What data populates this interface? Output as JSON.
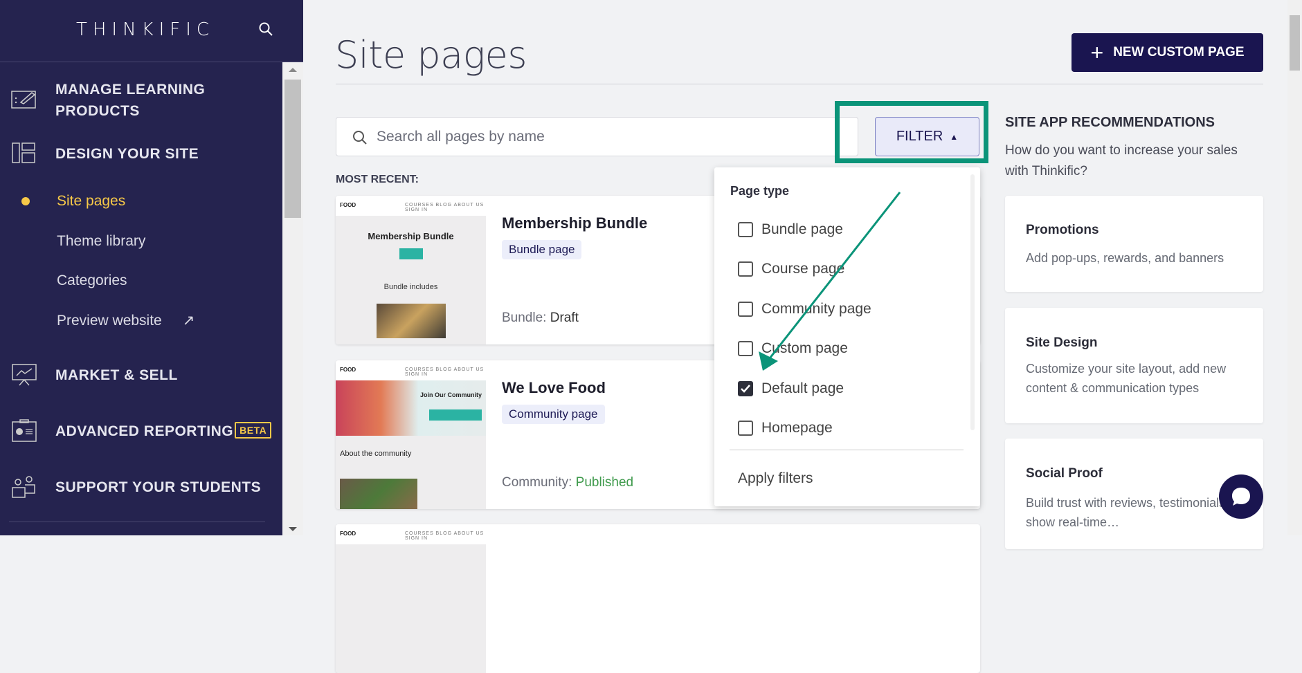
{
  "sidebar": {
    "logo": "THINKIFIC",
    "items": [
      {
        "label": "MANAGE LEARNING PRODUCTS",
        "icon": "edit-board-icon"
      },
      {
        "label": "DESIGN YOUR SITE",
        "icon": "layout-icon"
      },
      {
        "label": "MARKET & SELL",
        "icon": "presentation-chart-icon"
      },
      {
        "label": "ADVANCED REPORTING",
        "badge": "BETA",
        "icon": "report-icon"
      },
      {
        "label": "SUPPORT YOUR STUDENTS",
        "icon": "users-icon"
      }
    ],
    "subitems": [
      {
        "label": "Site pages",
        "active": true
      },
      {
        "label": "Theme library"
      },
      {
        "label": "Categories"
      },
      {
        "label": "Preview website",
        "icon": "external-link-icon"
      }
    ]
  },
  "header": {
    "title": "Site pages",
    "new_button": "NEW CUSTOM PAGE"
  },
  "search": {
    "placeholder": "Search all pages by name",
    "value": ""
  },
  "filter": {
    "label": "FILTER",
    "heading": "Page type",
    "options": [
      {
        "label": "Bundle page",
        "checked": false
      },
      {
        "label": "Course page",
        "checked": false
      },
      {
        "label": "Community page",
        "checked": false
      },
      {
        "label": "Custom page",
        "checked": false
      },
      {
        "label": "Default page",
        "checked": true
      },
      {
        "label": "Homepage",
        "checked": false
      }
    ],
    "apply": "Apply filters"
  },
  "recent_label": "MOST RECENT:",
  "pages": [
    {
      "title": "Membership Bundle",
      "badge": "Bundle page",
      "status_label": "Bundle:",
      "status": "Draft",
      "thumb": {
        "brand": "FOOD",
        "nav": "COURSES BLOG ABOUT US SIGN IN",
        "heading": "Membership Bundle",
        "sub": "Bundle includes"
      }
    },
    {
      "title": "We Love Food",
      "badge": "Community page",
      "status_label": "Community:",
      "status": "Published",
      "thumb": {
        "brand": "FOOD",
        "nav": "COURSES BLOG ABOUT US SIGN IN",
        "heading": "Join Our Community",
        "sub": "About the community"
      }
    },
    {
      "thumb": {
        "brand": "FOOD",
        "nav": "COURSES BLOG ABOUT US SIGN IN"
      }
    }
  ],
  "recommendations": {
    "heading": "SITE APP RECOMMENDATIONS",
    "subheading": "How do you want to increase your sales with Thinkific?",
    "cards": [
      {
        "title": "Promotions",
        "desc": "Add pop-ups, rewards, and banners"
      },
      {
        "title": "Site Design",
        "desc": "Customize your site layout, add new content & communication types"
      },
      {
        "title": "Social Proof",
        "desc": "Build trust with reviews, testimonials, show real-time…"
      }
    ]
  },
  "colors": {
    "sidebar": "#25234f",
    "accent": "#f7c948",
    "primary": "#1a1550",
    "annotation": "#0b9479",
    "published": "#3f9a4c"
  }
}
